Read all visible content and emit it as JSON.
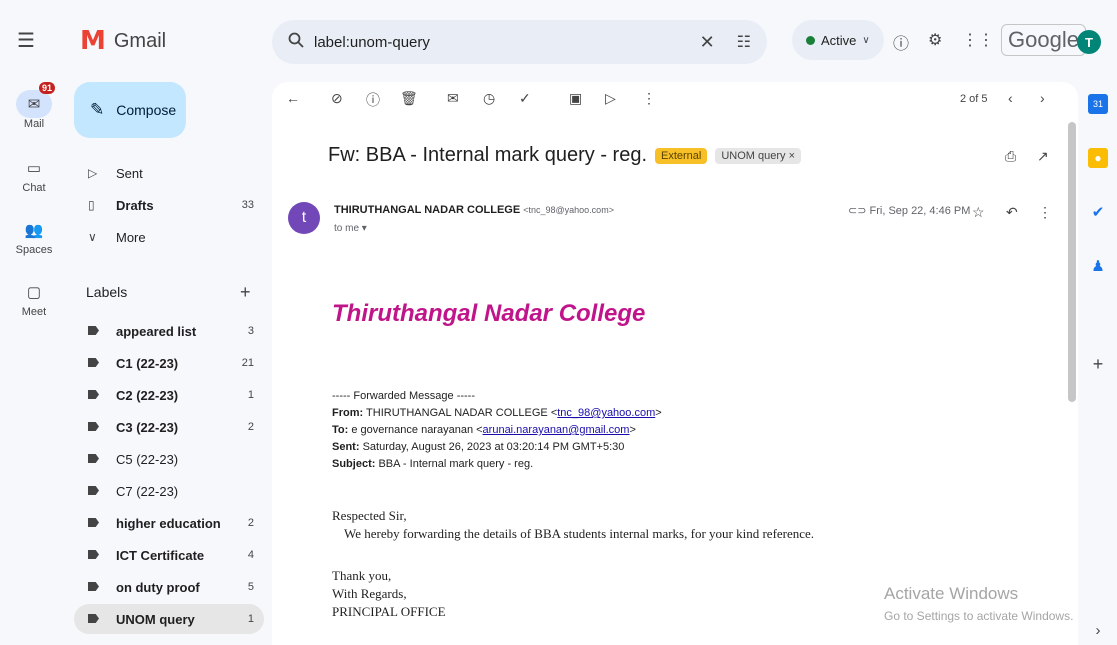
{
  "app": {
    "name": "Gmail"
  },
  "search": {
    "query": "label:unom-query"
  },
  "status": {
    "label": "Active"
  },
  "brand": {
    "google": "Google",
    "avatar_letter": "T"
  },
  "rail": [
    {
      "label": "Mail",
      "badge": "91"
    },
    {
      "label": "Chat"
    },
    {
      "label": "Spaces"
    },
    {
      "label": "Meet"
    }
  ],
  "compose": {
    "label": "Compose"
  },
  "nav": {
    "sent": "Sent",
    "drafts": {
      "label": "Drafts",
      "count": "33"
    },
    "more": "More"
  },
  "labels": {
    "heading": "Labels",
    "items": [
      {
        "label": "appeared list",
        "count": "3",
        "bold": true
      },
      {
        "label": "C1 (22-23)",
        "count": "21",
        "bold": true
      },
      {
        "label": "C2 (22-23)",
        "count": "1",
        "bold": true
      },
      {
        "label": "C3 (22-23)",
        "count": "2",
        "bold": true
      },
      {
        "label": "C5 (22-23)",
        "count": "",
        "bold": false
      },
      {
        "label": "C7 (22-23)",
        "count": "",
        "bold": false
      },
      {
        "label": "higher education",
        "count": "2",
        "bold": true
      },
      {
        "label": "ICT Certificate",
        "count": "4",
        "bold": true
      },
      {
        "label": "on duty proof",
        "count": "5",
        "bold": true
      },
      {
        "label": "UNOM query",
        "count": "1",
        "bold": true
      }
    ]
  },
  "reader": {
    "pager": "2 of 5",
    "subject": "Fw: BBA - Internal mark query - reg.",
    "chip_external": "External",
    "chip_label": "UNOM query ×",
    "sender_initial": "t",
    "sender_name": "THIRUTHANGAL NADAR COLLEGE",
    "sender_email": "<tnc_98@yahoo.com>",
    "to_me": "to me ▾",
    "date": "Fri, Sep 22, 4:46 PM",
    "college_title": "Thiruthangal Nadar College",
    "forwarded_header": "----- Forwarded Message -----",
    "from_label": "From:",
    "from_text": "THIRUTHANGAL NADAR COLLEGE <",
    "from_email": "tnc_98@yahoo.com",
    "to_label": "To:",
    "to_text": "e governance narayanan <",
    "to_email": "arunai.narayanan@gmail.com",
    "sent_label": "Sent:",
    "sent_text": "Saturday, August 26, 2023 at 03:20:14 PM GMT+5:30",
    "subject_label": "Subject:",
    "subject_text": "BBA - Internal mark query - reg.",
    "greeting": "Respected Sir,",
    "body_line": "We hereby forwarding the details of BBA students internal marks, for your kind reference.",
    "thanks": "Thank you,",
    "regards": "With Regards,",
    "office": "PRINCIPAL OFFICE"
  },
  "watermark": {
    "title": "Activate Windows",
    "subtitle": "Go to Settings to activate Windows."
  },
  "colors": {
    "background": "#f6f8fc",
    "compose": "#c2e7ff",
    "external_chip": "#f6c026",
    "college_title": "#c0148a",
    "sender_avatar": "#7248b9",
    "badge": "#c5221f"
  }
}
